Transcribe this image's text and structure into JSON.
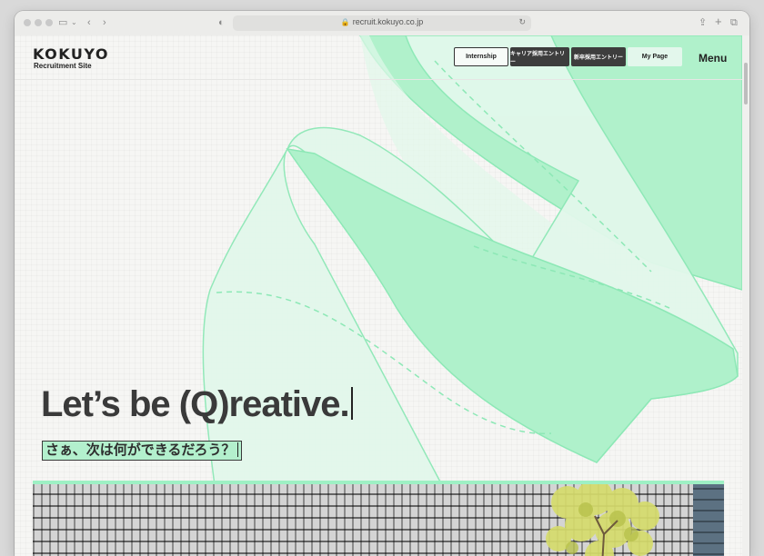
{
  "browser": {
    "url": "recruit.kokuyo.co.jp"
  },
  "header": {
    "logo": "KOKUYO",
    "logo_sub": "Recruitment Site",
    "nav": {
      "internship": "Internship",
      "career_entry": "キャリア採用エントリー",
      "new_grad_entry": "新卒採用エントリー",
      "my_page": "My Page",
      "menu": "Menu"
    }
  },
  "hero": {
    "headline": "Let’s be (Q)reative.",
    "subline": "さぁ、次は何ができるだろう？"
  },
  "colors": {
    "accent_green": "#9ef0c4",
    "dark_button": "#3d3d3d"
  }
}
